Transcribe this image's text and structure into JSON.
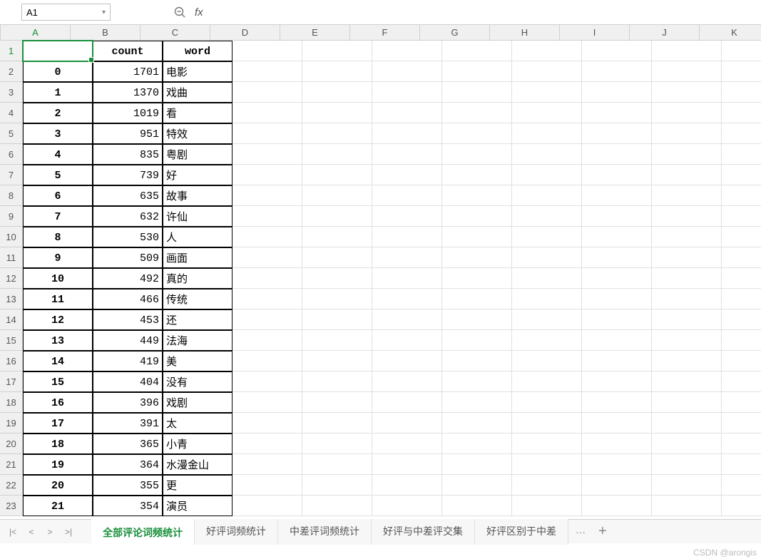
{
  "name_box": "A1",
  "fx_label": "fx",
  "formula_value": "",
  "columns": [
    "A",
    "B",
    "C",
    "D",
    "E",
    "F",
    "G",
    "H",
    "I",
    "J",
    "K"
  ],
  "row_numbers": [
    1,
    2,
    3,
    4,
    5,
    6,
    7,
    8,
    9,
    10,
    11,
    12,
    13,
    14,
    15,
    16,
    17,
    18,
    19,
    20,
    21,
    22,
    23
  ],
  "headers": {
    "b": "count",
    "c": "word"
  },
  "table": [
    {
      "idx": "0",
      "count": "1701",
      "word": "电影"
    },
    {
      "idx": "1",
      "count": "1370",
      "word": "戏曲"
    },
    {
      "idx": "2",
      "count": "1019",
      "word": "看"
    },
    {
      "idx": "3",
      "count": "951",
      "word": "特效"
    },
    {
      "idx": "4",
      "count": "835",
      "word": "粤剧"
    },
    {
      "idx": "5",
      "count": "739",
      "word": "好"
    },
    {
      "idx": "6",
      "count": "635",
      "word": "故事"
    },
    {
      "idx": "7",
      "count": "632",
      "word": "许仙"
    },
    {
      "idx": "8",
      "count": "530",
      "word": "人"
    },
    {
      "idx": "9",
      "count": "509",
      "word": "画面"
    },
    {
      "idx": "10",
      "count": "492",
      "word": "真的"
    },
    {
      "idx": "11",
      "count": "466",
      "word": "传统"
    },
    {
      "idx": "12",
      "count": "453",
      "word": "还"
    },
    {
      "idx": "13",
      "count": "449",
      "word": "法海"
    },
    {
      "idx": "14",
      "count": "419",
      "word": "美"
    },
    {
      "idx": "15",
      "count": "404",
      "word": "没有"
    },
    {
      "idx": "16",
      "count": "396",
      "word": "戏剧"
    },
    {
      "idx": "17",
      "count": "391",
      "word": "太"
    },
    {
      "idx": "18",
      "count": "365",
      "word": "小青"
    },
    {
      "idx": "19",
      "count": "364",
      "word": "水漫金山"
    },
    {
      "idx": "20",
      "count": "355",
      "word": "更"
    },
    {
      "idx": "21",
      "count": "354",
      "word": "演员"
    }
  ],
  "sheets": {
    "active": "全部评论词频统计",
    "tabs": [
      "全部评论词频统计",
      "好评词频统计",
      "中差评词频统计",
      "好评与中差评交集",
      "好评区别于中差"
    ],
    "more": "···",
    "add": "+"
  },
  "watermark": "CSDN @arongis"
}
